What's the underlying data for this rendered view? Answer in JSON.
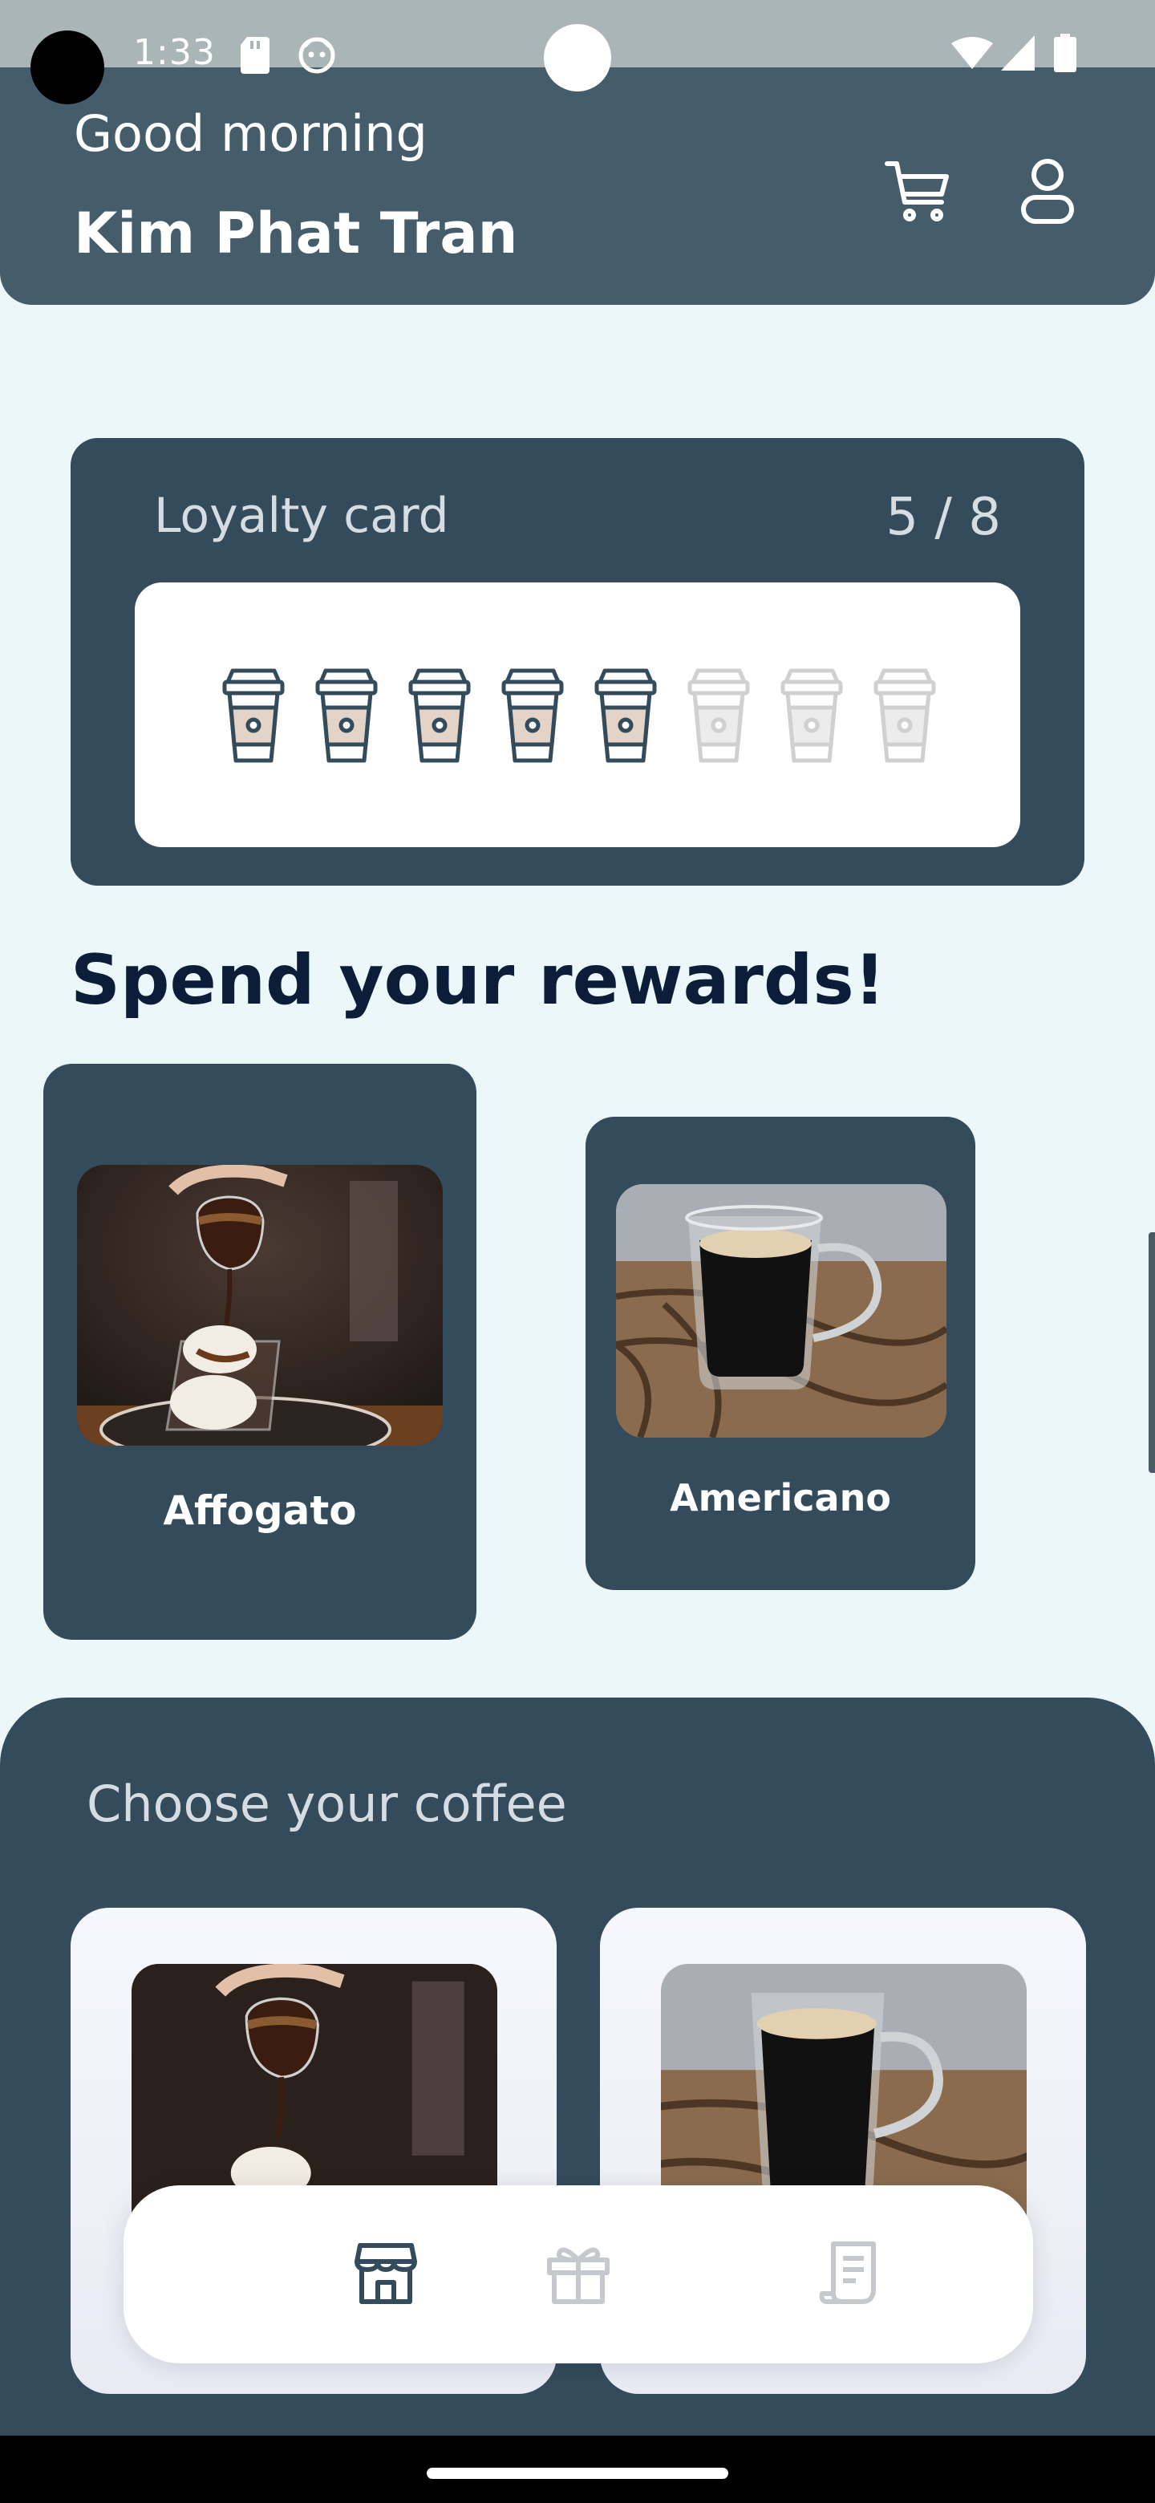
{
  "status_bar": {
    "time": "1:33",
    "icons": [
      "sd-card-icon",
      "face-icon",
      "wifi-icon",
      "signal-icon",
      "battery-icon"
    ]
  },
  "header": {
    "greeting": "Good morning",
    "user_name": "Kim Phat Tran",
    "icons": [
      "cart-icon",
      "profile-icon"
    ]
  },
  "loyalty_card": {
    "title": "Loyalty card",
    "count_text": "5 / 8",
    "stamps_collected": 5,
    "stamps_total": 8
  },
  "rewards": {
    "title": "Spend your rewards!",
    "items": [
      {
        "name": "Affogato",
        "image": "affogato-photo"
      },
      {
        "name": "Americano",
        "image": "americano-photo"
      }
    ]
  },
  "menu": {
    "title": "Choose your coffee",
    "items": [
      {
        "image": "affogato-photo"
      },
      {
        "image": "americano-photo"
      }
    ]
  },
  "bottom_nav": {
    "items": [
      {
        "icon": "store-icon",
        "active": true
      },
      {
        "icon": "gift-icon",
        "active": false
      },
      {
        "icon": "receipt-icon",
        "active": false
      }
    ]
  },
  "colors": {
    "header_bg": "#455d6b",
    "card_bg": "#344b5c",
    "page_bg": "#ebf7f9",
    "title_dark": "#0c1d3a",
    "stamp_fill": "#e4d4c8",
    "stamp_stroke": "#344b5c",
    "stamp_empty": "#d0d0d0"
  }
}
